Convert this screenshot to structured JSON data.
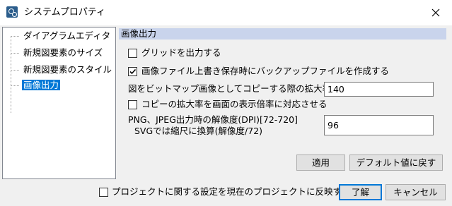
{
  "window": {
    "title": "システムプロパティ",
    "app_icon": "app-logo-icon",
    "close_icon": "close-icon"
  },
  "tree": {
    "items": [
      {
        "label": "ダイアグラムエディタ",
        "selected": false
      },
      {
        "label": "新規図要素のサイズ",
        "selected": false
      },
      {
        "label": "新規図要素のスタイル",
        "selected": false
      },
      {
        "label": "画像出力",
        "selected": true
      }
    ]
  },
  "section": {
    "title": "画像出力",
    "grid_output": {
      "label": "グリッドを出力する",
      "checked": false
    },
    "backup": {
      "label": "画像ファイル上書き保存時にバックアップファイルを作成する",
      "checked": true
    },
    "scale": {
      "label": "図をビットマップ画像としてコピーする際の拡大率(%)",
      "value": "140"
    },
    "sync_zoom": {
      "label": "コピーの拡大率を画面の表示倍率に対応させる",
      "checked": false
    },
    "dpi": {
      "label_line1": "PNG、JPEG出力時の解像度(DPI)[72-720]",
      "label_line2": "SVGでは縮尺に換算(解像度/72)",
      "value": "96"
    }
  },
  "buttons": {
    "apply": "適用",
    "reset_default": "デフォルト値に戻す",
    "ok": "了解",
    "cancel": "キャンセル"
  },
  "footer": {
    "reflect": {
      "label": "プロジェクトに関する設定を現在のプロジェクトに反映する",
      "checked": false
    }
  },
  "colors": {
    "section_header_bg": "#c9d4ec",
    "selection_bg": "#0078d7",
    "window_bg": "#f0f0f0"
  }
}
